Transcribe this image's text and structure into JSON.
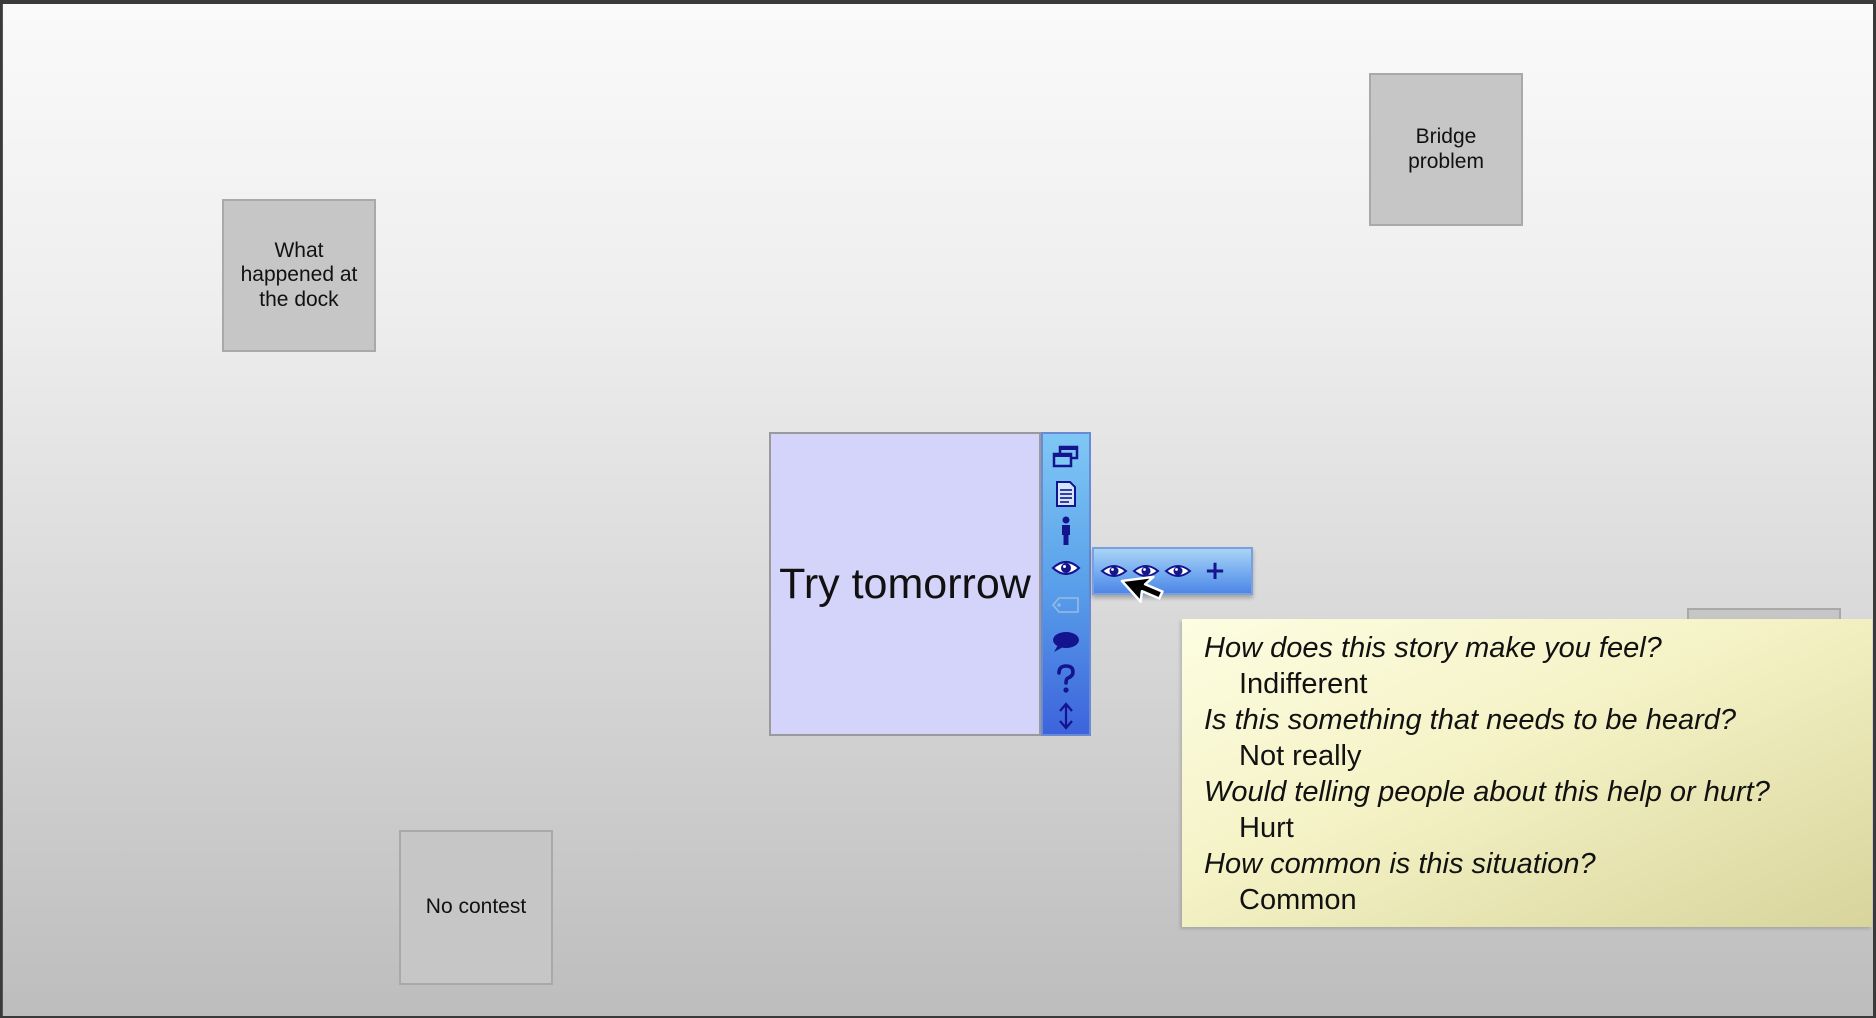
{
  "notes": {
    "dock": "What happened at the dock",
    "bridge": "Bridge problem",
    "contest": "No contest",
    "main": "Try tomorrow"
  },
  "toolbar": {
    "icons": [
      "windows-icon",
      "document-icon",
      "person-icon",
      "eye-icon",
      "tag-icon",
      "speech-bubble-icon",
      "question-icon",
      "resize-vertical-icon"
    ]
  },
  "eye_menu": {
    "options": [
      "eye-icon",
      "eye-icon",
      "eye-icon"
    ],
    "add_label": "+"
  },
  "tooltip": {
    "items": [
      {
        "question": "How does this story make you feel?",
        "answer": "Indifferent"
      },
      {
        "question": "Is this something that needs to be heard?",
        "answer": "Not really"
      },
      {
        "question": "Would telling people about this help or hurt?",
        "answer": "Hurt"
      },
      {
        "question": "How common is this situation?",
        "answer": "Common"
      }
    ]
  },
  "colors": {
    "main_note": "#d4d4fb",
    "icon": "#14148e",
    "tooltip_bg": "#f4f2c5"
  }
}
